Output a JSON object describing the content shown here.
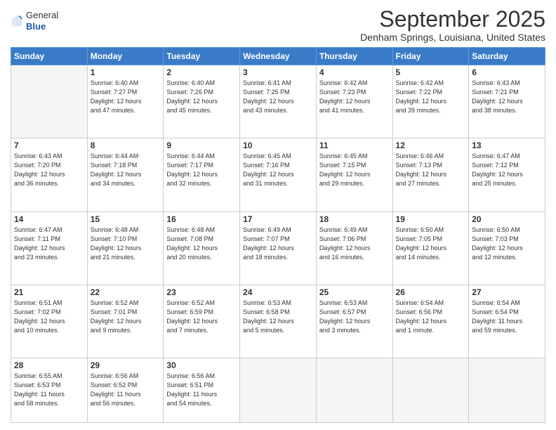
{
  "header": {
    "logo_line1": "General",
    "logo_line2": "Blue",
    "month": "September 2025",
    "location": "Denham Springs, Louisiana, United States"
  },
  "weekdays": [
    "Sunday",
    "Monday",
    "Tuesday",
    "Wednesday",
    "Thursday",
    "Friday",
    "Saturday"
  ],
  "weeks": [
    [
      {
        "day": "",
        "info": ""
      },
      {
        "day": "1",
        "info": "Sunrise: 6:40 AM\nSunset: 7:27 PM\nDaylight: 12 hours\nand 47 minutes."
      },
      {
        "day": "2",
        "info": "Sunrise: 6:40 AM\nSunset: 7:26 PM\nDaylight: 12 hours\nand 45 minutes."
      },
      {
        "day": "3",
        "info": "Sunrise: 6:41 AM\nSunset: 7:25 PM\nDaylight: 12 hours\nand 43 minutes."
      },
      {
        "day": "4",
        "info": "Sunrise: 6:42 AM\nSunset: 7:23 PM\nDaylight: 12 hours\nand 41 minutes."
      },
      {
        "day": "5",
        "info": "Sunrise: 6:42 AM\nSunset: 7:22 PM\nDaylight: 12 hours\nand 39 minutes."
      },
      {
        "day": "6",
        "info": "Sunrise: 6:43 AM\nSunset: 7:21 PM\nDaylight: 12 hours\nand 38 minutes."
      }
    ],
    [
      {
        "day": "7",
        "info": "Sunrise: 6:43 AM\nSunset: 7:20 PM\nDaylight: 12 hours\nand 36 minutes."
      },
      {
        "day": "8",
        "info": "Sunrise: 6:44 AM\nSunset: 7:18 PM\nDaylight: 12 hours\nand 34 minutes."
      },
      {
        "day": "9",
        "info": "Sunrise: 6:44 AM\nSunset: 7:17 PM\nDaylight: 12 hours\nand 32 minutes."
      },
      {
        "day": "10",
        "info": "Sunrise: 6:45 AM\nSunset: 7:16 PM\nDaylight: 12 hours\nand 31 minutes."
      },
      {
        "day": "11",
        "info": "Sunrise: 6:45 AM\nSunset: 7:15 PM\nDaylight: 12 hours\nand 29 minutes."
      },
      {
        "day": "12",
        "info": "Sunrise: 6:46 AM\nSunset: 7:13 PM\nDaylight: 12 hours\nand 27 minutes."
      },
      {
        "day": "13",
        "info": "Sunrise: 6:47 AM\nSunset: 7:12 PM\nDaylight: 12 hours\nand 25 minutes."
      }
    ],
    [
      {
        "day": "14",
        "info": "Sunrise: 6:47 AM\nSunset: 7:11 PM\nDaylight: 12 hours\nand 23 minutes."
      },
      {
        "day": "15",
        "info": "Sunrise: 6:48 AM\nSunset: 7:10 PM\nDaylight: 12 hours\nand 21 minutes."
      },
      {
        "day": "16",
        "info": "Sunrise: 6:48 AM\nSunset: 7:08 PM\nDaylight: 12 hours\nand 20 minutes."
      },
      {
        "day": "17",
        "info": "Sunrise: 6:49 AM\nSunset: 7:07 PM\nDaylight: 12 hours\nand 18 minutes."
      },
      {
        "day": "18",
        "info": "Sunrise: 6:49 AM\nSunset: 7:06 PM\nDaylight: 12 hours\nand 16 minutes."
      },
      {
        "day": "19",
        "info": "Sunrise: 6:50 AM\nSunset: 7:05 PM\nDaylight: 12 hours\nand 14 minutes."
      },
      {
        "day": "20",
        "info": "Sunrise: 6:50 AM\nSunset: 7:03 PM\nDaylight: 12 hours\nand 12 minutes."
      }
    ],
    [
      {
        "day": "21",
        "info": "Sunrise: 6:51 AM\nSunset: 7:02 PM\nDaylight: 12 hours\nand 10 minutes."
      },
      {
        "day": "22",
        "info": "Sunrise: 6:52 AM\nSunset: 7:01 PM\nDaylight: 12 hours\nand 9 minutes."
      },
      {
        "day": "23",
        "info": "Sunrise: 6:52 AM\nSunset: 6:59 PM\nDaylight: 12 hours\nand 7 minutes."
      },
      {
        "day": "24",
        "info": "Sunrise: 6:53 AM\nSunset: 6:58 PM\nDaylight: 12 hours\nand 5 minutes."
      },
      {
        "day": "25",
        "info": "Sunrise: 6:53 AM\nSunset: 6:57 PM\nDaylight: 12 hours\nand 3 minutes."
      },
      {
        "day": "26",
        "info": "Sunrise: 6:54 AM\nSunset: 6:56 PM\nDaylight: 12 hours\nand 1 minute."
      },
      {
        "day": "27",
        "info": "Sunrise: 6:54 AM\nSunset: 6:54 PM\nDaylight: 11 hours\nand 59 minutes."
      }
    ],
    [
      {
        "day": "28",
        "info": "Sunrise: 6:55 AM\nSunset: 6:53 PM\nDaylight: 11 hours\nand 58 minutes."
      },
      {
        "day": "29",
        "info": "Sunrise: 6:56 AM\nSunset: 6:52 PM\nDaylight: 11 hours\nand 56 minutes."
      },
      {
        "day": "30",
        "info": "Sunrise: 6:56 AM\nSunset: 6:51 PM\nDaylight: 11 hours\nand 54 minutes."
      },
      {
        "day": "",
        "info": ""
      },
      {
        "day": "",
        "info": ""
      },
      {
        "day": "",
        "info": ""
      },
      {
        "day": "",
        "info": ""
      }
    ]
  ]
}
